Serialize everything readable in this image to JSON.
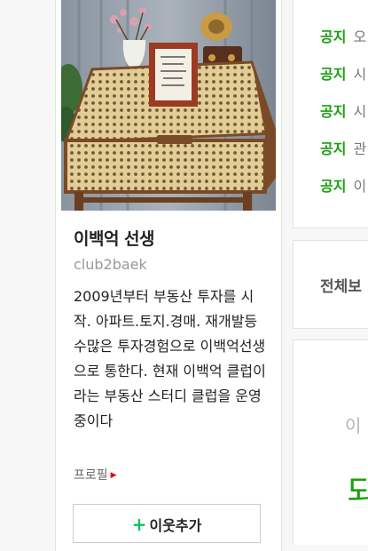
{
  "profile": {
    "photo_alt": "rattan cabinet with framed calligraphy, flowers and a small gramophone",
    "name": "이백억 선생",
    "id": "club2baek",
    "description": "2009년부터 부동산 투자를 시작. 아파트.토지.경매. 재개발등 수많은 투자경험으로 이백억선생으로 통한다. 현재 이백억 클럽이라는 부동산 스터디 클럽을 운영 중이다",
    "profile_link": "프로필",
    "add_neighbor_label": "이웃추가",
    "add_icon": "+"
  },
  "notices": {
    "items": [
      {
        "tag": "공지",
        "title": "오"
      },
      {
        "tag": "공지",
        "title": "시"
      },
      {
        "tag": "공지",
        "title": "시"
      },
      {
        "tag": "공지",
        "title": "관"
      },
      {
        "tag": "공지",
        "title": "이"
      }
    ]
  },
  "all_posts": {
    "label": "전체보"
  },
  "extra": {
    "faint_text": "이",
    "big_text": "되"
  },
  "colors": {
    "accent_green": "#1ba10f",
    "naver_green": "#03c75a",
    "profile_arrow": "#e0001b"
  }
}
